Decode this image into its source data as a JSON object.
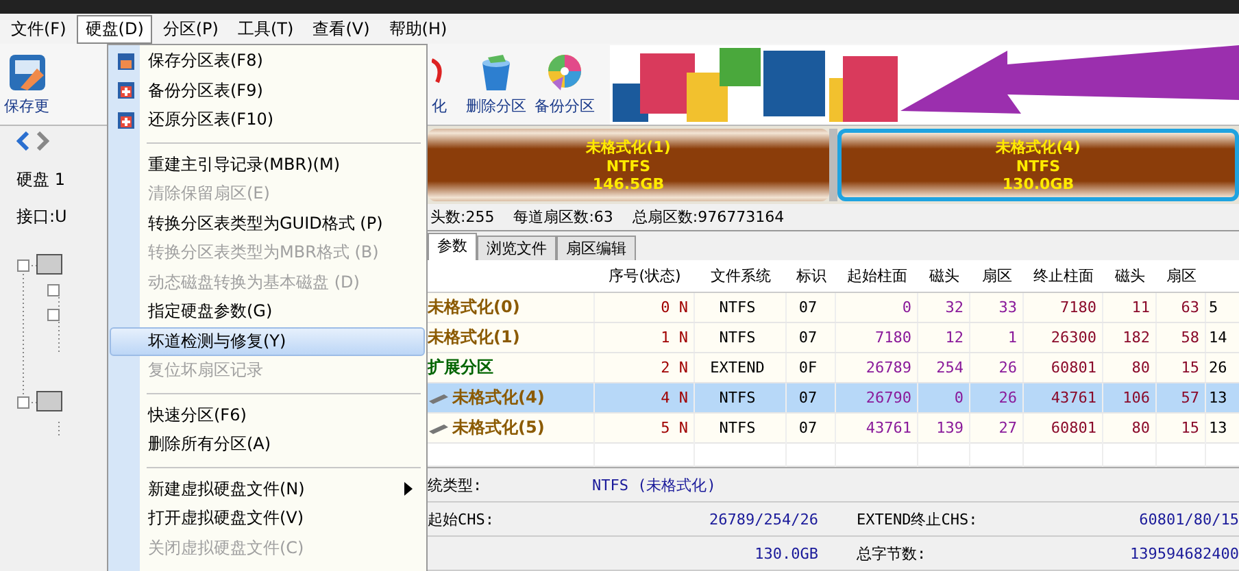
{
  "menu_bar": [
    {
      "label": "文件(F)",
      "selected": false
    },
    {
      "label": "硬盘(D)",
      "selected": true
    },
    {
      "label": "分区(P)",
      "selected": false
    },
    {
      "label": "工具(T)",
      "selected": false
    },
    {
      "label": "查看(V)",
      "selected": false
    },
    {
      "label": "帮助(H)",
      "selected": false
    }
  ],
  "dropdown": [
    {
      "kind": "item",
      "label": "保存分区表(F8)",
      "disabled": false,
      "selected": false
    },
    {
      "kind": "item",
      "label": "备份分区表(F9)",
      "disabled": false,
      "selected": false
    },
    {
      "kind": "item",
      "label": "还原分区表(F10)",
      "disabled": false,
      "selected": false
    },
    {
      "kind": "separator"
    },
    {
      "kind": "item",
      "label": "重建主引导记录(MBR)(M)",
      "disabled": false,
      "selected": false
    },
    {
      "kind": "item",
      "label": "清除保留扇区(E)",
      "disabled": true,
      "selected": false
    },
    {
      "kind": "item",
      "label": "转换分区表类型为GUID格式 (P)",
      "disabled": false,
      "selected": false
    },
    {
      "kind": "item",
      "label": "转换分区表类型为MBR格式 (B)",
      "disabled": true,
      "selected": false
    },
    {
      "kind": "item",
      "label": "动态磁盘转换为基本磁盘 (D)",
      "disabled": true,
      "selected": false
    },
    {
      "kind": "item",
      "label": "指定硬盘参数(G)",
      "disabled": false,
      "selected": false
    },
    {
      "kind": "item",
      "label": "坏道检测与修复(Y)",
      "disabled": false,
      "selected": true
    },
    {
      "kind": "item",
      "label": "复位坏扇区记录",
      "disabled": true,
      "selected": false
    },
    {
      "kind": "separator"
    },
    {
      "kind": "item",
      "label": "快速分区(F6)",
      "disabled": false,
      "selected": false
    },
    {
      "kind": "item",
      "label": "删除所有分区(A)",
      "disabled": false,
      "selected": false
    },
    {
      "kind": "separator"
    },
    {
      "kind": "item",
      "label": "新建虚拟硬盘文件(N)",
      "disabled": false,
      "selected": false,
      "submenu": true
    },
    {
      "kind": "item",
      "label": "打开虚拟硬盘文件(V)",
      "disabled": false,
      "selected": false
    },
    {
      "kind": "item",
      "label": "关闭虚拟硬盘文件(C)",
      "disabled": true,
      "selected": false
    }
  ],
  "toolbar": [
    {
      "label": "保存更"
    },
    {
      "label": "化"
    },
    {
      "label": "删除分区"
    },
    {
      "label": "备份分区"
    }
  ],
  "left_panel": {
    "disk": "硬盘 1",
    "interface": "接口:U"
  },
  "disk_map": [
    {
      "name": "未格式化(1)",
      "fs": "NTFS",
      "size": "146.5GB",
      "selected": false
    },
    {
      "name": "未格式化(4)",
      "fs": "NTFS",
      "size": "130.0GB",
      "selected": true
    }
  ],
  "disk_info": [
    "头数:255",
    "每道扇区数:63",
    "总扇区数:976773164"
  ],
  "tabs": [
    {
      "label": "参数",
      "selected": true
    },
    {
      "label": "浏览文件",
      "selected": false
    },
    {
      "label": "扇区编辑",
      "selected": false
    }
  ],
  "table": {
    "columns": [
      "",
      "序号(状态)",
      "文件系统",
      "标识",
      "起始柱面",
      "磁头",
      "扇区",
      "终止柱面",
      "磁头",
      "扇区",
      ""
    ],
    "rows": [
      {
        "color": "#8b5a00",
        "selected": false,
        "cells": [
          "未格式化(0)",
          "0 N",
          "NTFS",
          "07",
          "0",
          "32",
          "33",
          "7180",
          "11",
          "63",
          "5"
        ]
      },
      {
        "color": "#8b5a00",
        "selected": false,
        "cells": [
          "未格式化(1)",
          "1 N",
          "NTFS",
          "07",
          "7180",
          "12",
          "1",
          "26300",
          "182",
          "58",
          "14"
        ]
      },
      {
        "color": "#006400",
        "selected": false,
        "cells": [
          "扩展分区",
          "2 N",
          "EXTEND",
          "0F",
          "26789",
          "254",
          "26",
          "60801",
          "80",
          "15",
          "26"
        ],
        "children": [
          {
            "color": "#8b5a00",
            "selected": true,
            "cells": [
              "未格式化(4)",
              "4 N",
              "NTFS",
              "07",
              "26790",
              "0",
              "26",
              "43761",
              "106",
              "57",
              "13"
            ]
          },
          {
            "color": "#8b5a00",
            "selected": false,
            "cells": [
              "未格式化(5)",
              "5 N",
              "NTFS",
              "07",
              "43761",
              "139",
              "27",
              "60801",
              "80",
              "15",
              "13"
            ]
          }
        ]
      }
    ]
  },
  "details": [
    {
      "label": "统类型:",
      "value": "NTFS (未格式化)"
    },
    {
      "label": "起始CHS:",
      "value": "26789/254/26",
      "label2": "EXTEND终止CHS:",
      "value2": "60801/80/15"
    },
    {
      "value": "130.0GB",
      "label2": "总字节数:",
      "value2": "139594682400"
    }
  ]
}
